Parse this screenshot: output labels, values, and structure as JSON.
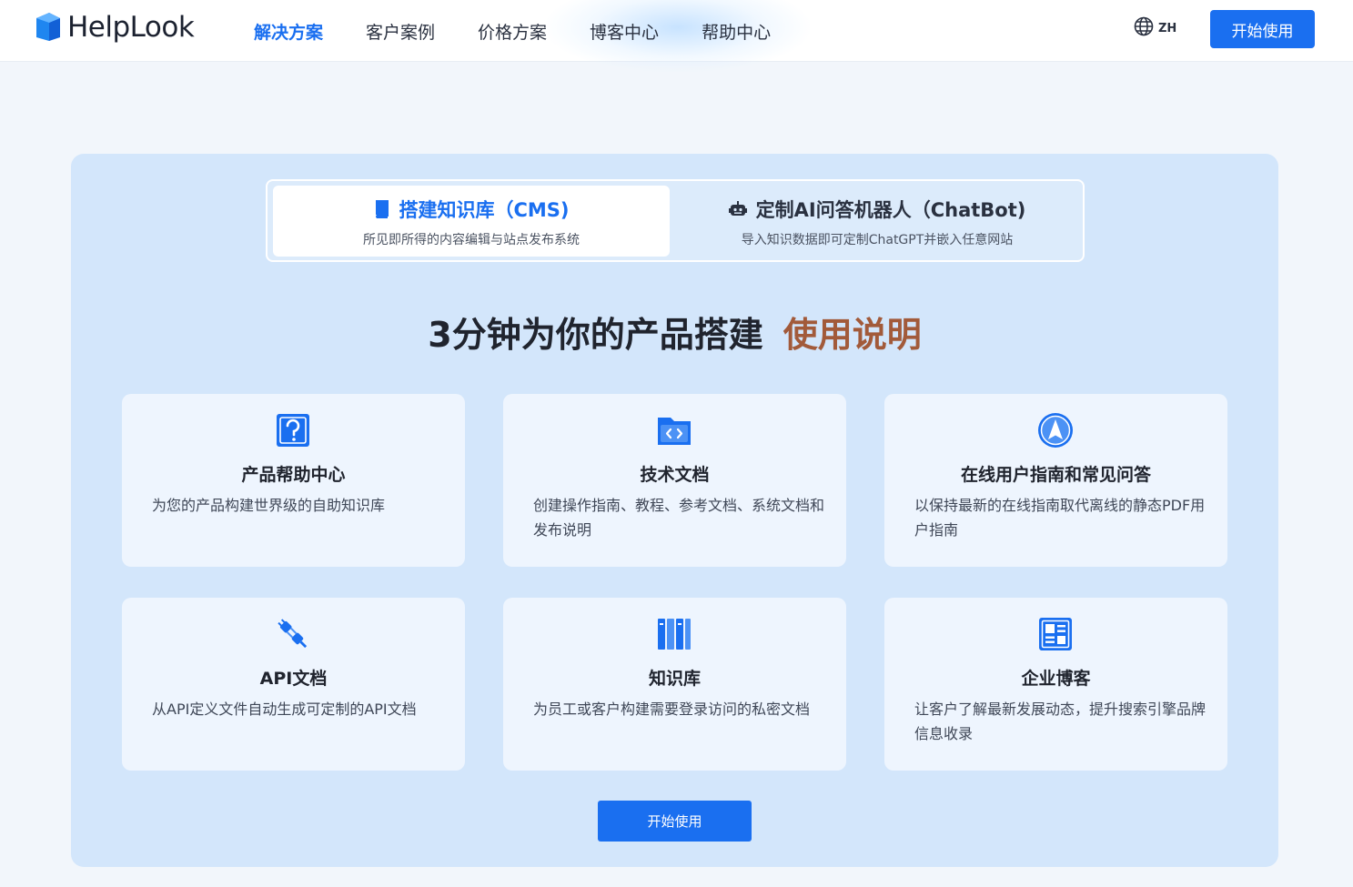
{
  "brand": {
    "name": "HelpLook"
  },
  "nav": {
    "links": [
      {
        "label": "解决方案",
        "active": true
      },
      {
        "label": "客户案例",
        "active": false
      },
      {
        "label": "价格方案",
        "active": false
      },
      {
        "label": "博客中心",
        "active": false
      },
      {
        "label": "帮助中心",
        "active": false
      }
    ],
    "lang": "ZH",
    "cta": "开始使用"
  },
  "tabs": [
    {
      "title": "搭建知识库（CMS)",
      "subtitle": "所见即所得的内容编辑与站点发布系统",
      "icon": "book-icon",
      "active": true
    },
    {
      "title": "定制AI问答机器人（ChatBot)",
      "subtitle": "导入知识数据即可定制ChatGPT并嵌入任意网站",
      "icon": "robot-icon",
      "active": false
    }
  ],
  "headline": {
    "main": "3分钟为你的产品搭建",
    "accent": "使用说明"
  },
  "cards": [
    {
      "title": "产品帮助中心",
      "desc": "为您的产品构建世界级的自助知识库",
      "icon": "question-icon"
    },
    {
      "title": "技术文档",
      "desc": "创建操作指南、教程、参考文档、系统文档和发布说明",
      "icon": "code-folder-icon"
    },
    {
      "title": "在线用户指南和常见问答",
      "desc": "以保持最新的在线指南取代离线的静态PDF用户指南",
      "icon": "navigation-icon"
    },
    {
      "title": "API文档",
      "desc": "从API定义文件自动生成可定制的API文档",
      "icon": "plug-icon"
    },
    {
      "title": "知识库",
      "desc": "为员工或客户构建需要登录访问的私密文档",
      "icon": "library-icon"
    },
    {
      "title": "企业博客",
      "desc": "让客户了解最新发展动态，提升搜索引擎品牌信息收录",
      "icon": "blog-icon"
    }
  ],
  "cta": {
    "label": "开始使用"
  },
  "colors": {
    "accent": "#1a6ff0",
    "headline_accent": "#a25a3a",
    "panel": "#d3e6fb",
    "card": "#eef5fe"
  }
}
